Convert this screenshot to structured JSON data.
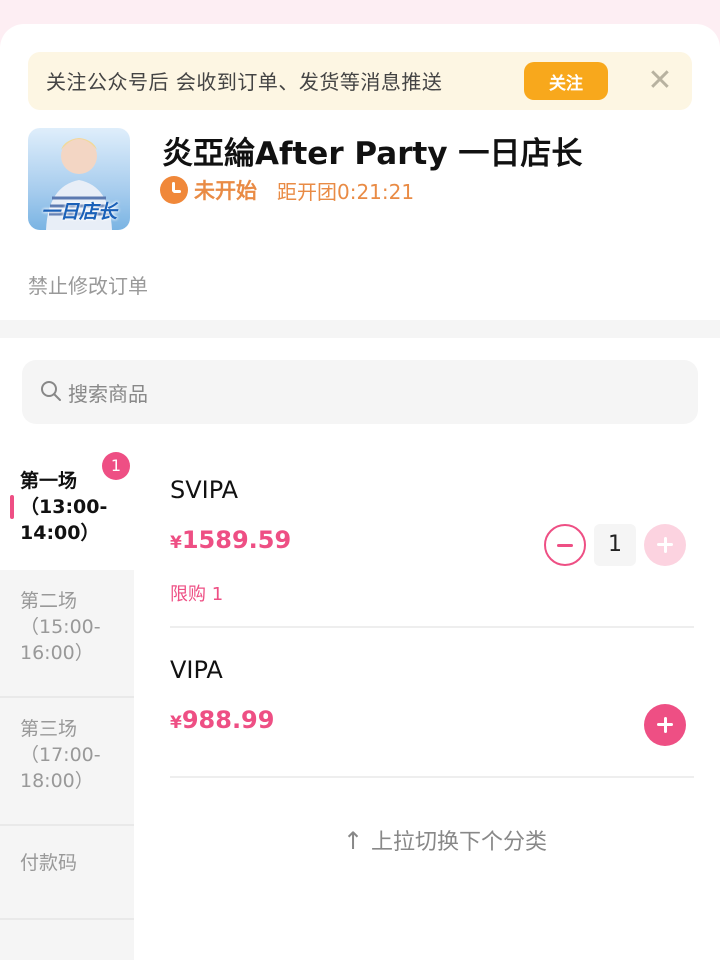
{
  "notice": {
    "text": "关注公众号后 会收到订单、发货等消息推送",
    "follow_label": "关注",
    "close_glyph": "✕"
  },
  "store": {
    "cover_icon": "store-cover-image",
    "cover_text": "一日店长",
    "title": "炎亞綸After Party 一日店长",
    "status": "未开始",
    "countdown": "距开团0:21:21",
    "note": "禁止修改订单"
  },
  "search": {
    "placeholder": "搜索商品"
  },
  "sidebar": {
    "items": [
      {
        "label": "第一场（13:00-14:00）",
        "badge": "1",
        "active": true
      },
      {
        "label": "第二场（15:00-16:00）",
        "active": false
      },
      {
        "label": "第三场（17:00-18:00）",
        "active": false
      },
      {
        "label": "付款码",
        "active": false
      }
    ]
  },
  "products": [
    {
      "name": "SVIPA",
      "currency": "¥",
      "price": "1589.59",
      "limit": "限购 1",
      "quantity": "1"
    },
    {
      "name": "VIPA",
      "currency": "¥",
      "price": "988.99"
    }
  ],
  "pull_hint": {
    "arrow": "↑",
    "text": "上拉切换下个分类"
  },
  "colors": {
    "accent": "#ee4f84",
    "follow_button": "#f8a81c",
    "status_orange": "#e98b45"
  }
}
